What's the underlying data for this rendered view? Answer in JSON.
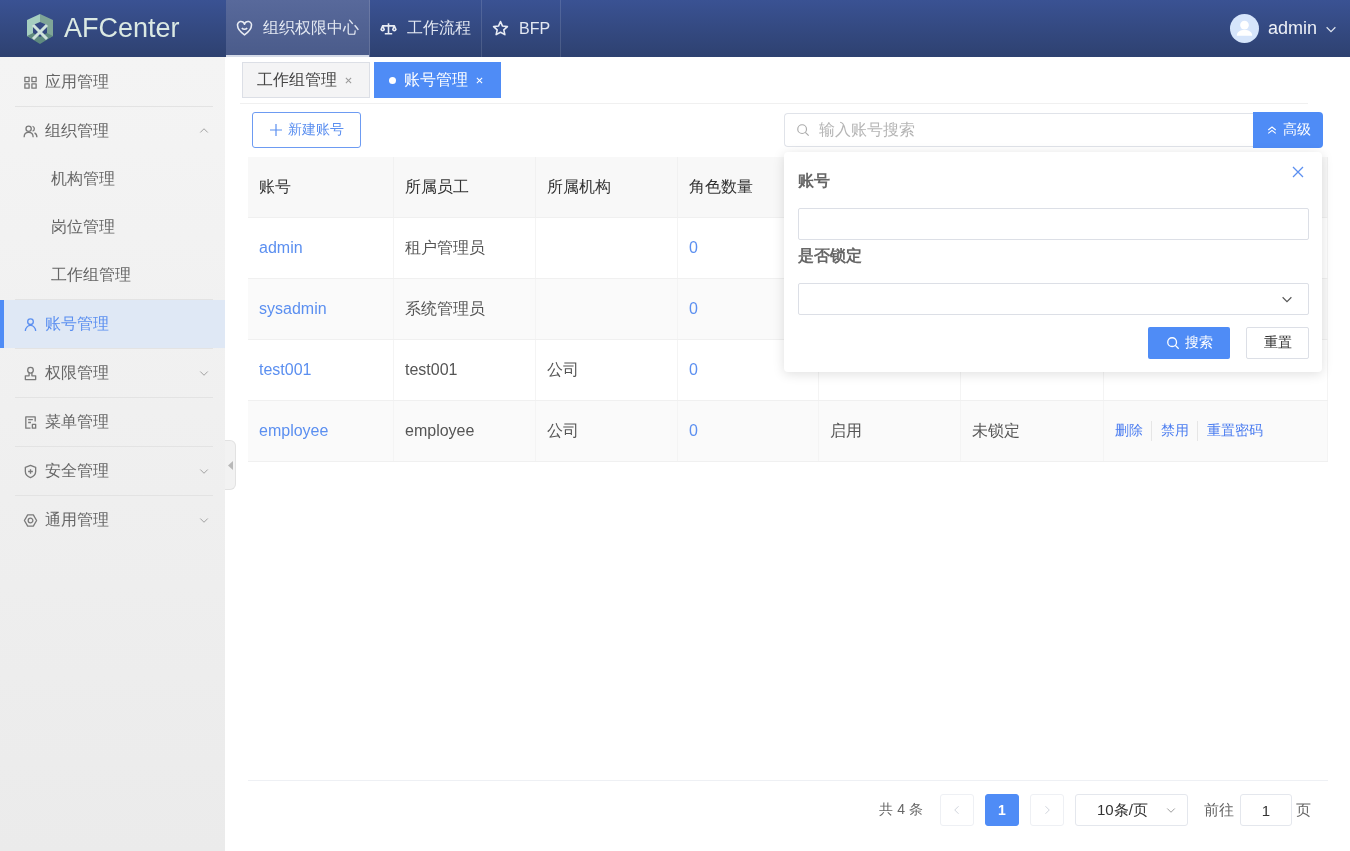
{
  "top_bar": {
    "logo_text": "AFCenter",
    "nav": [
      {
        "label": "组织权限中心",
        "selected": true
      },
      {
        "label": "工作流程",
        "selected": false
      },
      {
        "label": "BFP",
        "selected": false
      }
    ],
    "user": "admin"
  },
  "sidebar": {
    "items": [
      {
        "label": "应用管理",
        "kind": "leaf",
        "selected": false
      },
      {
        "label": "组织管理",
        "kind": "group",
        "expanded": true,
        "selected": false,
        "children": [
          {
            "label": "机构管理",
            "selected": false
          },
          {
            "label": "岗位管理",
            "selected": false
          },
          {
            "label": "工作组管理",
            "selected": false
          }
        ]
      },
      {
        "label": "账号管理",
        "kind": "leaf",
        "selected": true
      },
      {
        "label": "权限管理",
        "kind": "group",
        "expanded": false,
        "selected": false
      },
      {
        "label": "菜单管理",
        "kind": "leaf",
        "selected": false
      },
      {
        "label": "安全管理",
        "kind": "group",
        "expanded": false,
        "selected": false
      },
      {
        "label": "通用管理",
        "kind": "group",
        "expanded": false,
        "selected": false
      }
    ]
  },
  "tabs": [
    {
      "label": "工作组管理",
      "selected": false
    },
    {
      "label": "账号管理",
      "selected": true
    }
  ],
  "toolbar": {
    "new_button": "新建账号",
    "search": {
      "placeholder": "输入账号搜索"
    },
    "advanced_button": "高级"
  },
  "advanced_search": {
    "open": true,
    "fields": [
      {
        "label": "账号",
        "kind": "input"
      },
      {
        "label": "是否锁定",
        "kind": "select"
      }
    ],
    "buttons": [
      {
        "label": "搜索",
        "kind": "primary"
      },
      {
        "label": "重置",
        "kind": "default"
      }
    ]
  },
  "table": {
    "columns": [
      "账号",
      "所属员工",
      "所属机构",
      "角色数量"
    ],
    "rows": [
      {
        "account": "admin",
        "employee": "租户管理员",
        "role_count": "0"
      },
      {
        "account": "sysadmin",
        "employee": "系统管理员",
        "role_count": "0"
      },
      {
        "account": "test001",
        "employee": "test001",
        "organization": "公司",
        "role_count": "0"
      },
      {
        "account": "employee",
        "employee": "employee",
        "organization": "公司",
        "role_count": "0",
        "column_5": "启用",
        "column_6": "未锁定",
        "column_7": [
          "删除",
          "禁用",
          "重置密码"
        ]
      }
    ]
  },
  "pagination": {
    "total": "共 4 条",
    "prev_disabled": true,
    "pages": [
      {
        "label": "1",
        "selected": true
      }
    ],
    "next_disabled": true,
    "page_size": "10条/页",
    "goto_label": "前往",
    "goto_value": "1",
    "goto_suffix": "页"
  }
}
